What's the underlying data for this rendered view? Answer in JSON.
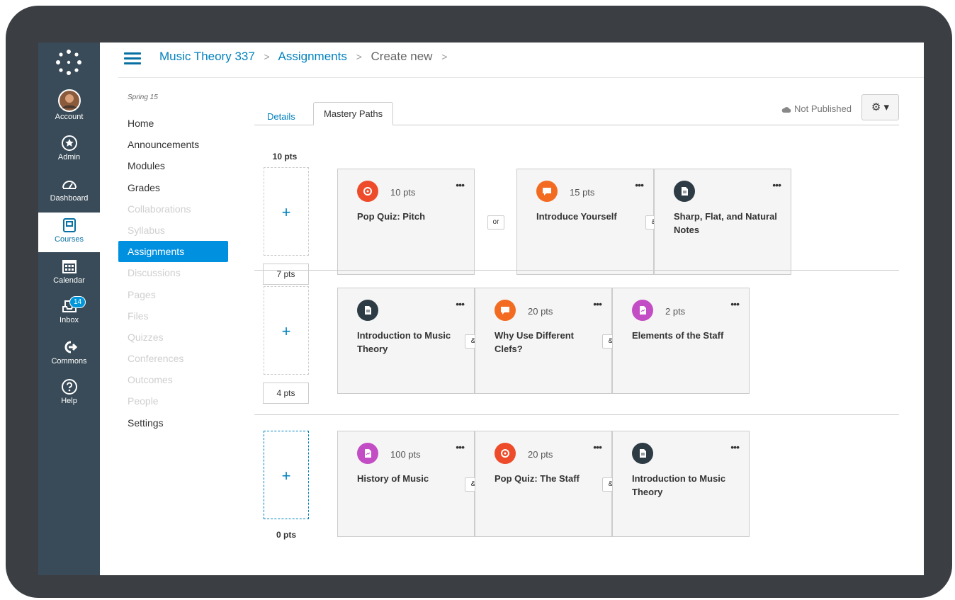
{
  "nav": {
    "account": "Account",
    "admin": "Admin",
    "dashboard": "Dashboard",
    "courses": "Courses",
    "calendar": "Calendar",
    "inbox": "Inbox",
    "inbox_count": "14",
    "commons": "Commons",
    "help": "Help"
  },
  "breadcrumb": {
    "course": "Music Theory 337",
    "section": "Assignments",
    "current": "Create new",
    "sep": ">"
  },
  "course_nav": {
    "term": "Spring 15",
    "items": [
      "Home",
      "Announcements",
      "Modules",
      "Grades",
      "Collaborations",
      "Syllabus",
      "Assignments",
      "Discussions",
      "Pages",
      "Files",
      "Quizzes",
      "Conferences",
      "Outcomes",
      "People",
      "Settings"
    ]
  },
  "tabs": {
    "details": "Details",
    "mastery": "Mastery Paths"
  },
  "status": {
    "published": "Not Published",
    "gear": "⚙ ▾"
  },
  "add_symbol": "+",
  "more_symbol": "•••",
  "rows": [
    {
      "top_label": "10 pts",
      "bottom_label": "7 pts",
      "cards": [
        {
          "icon": "quiz-icon",
          "color": "#ee4b2b",
          "pts": "10 pts",
          "title": "Pop Quiz: Pitch"
        },
        {
          "icon": "discussion-icon",
          "color": "#f26b21",
          "pts": "15 pts",
          "title": "Introduce Yourself"
        },
        {
          "icon": "page-icon",
          "color": "#2d3b45",
          "pts": "",
          "title": "Sharp, Flat, and Natural Notes"
        }
      ],
      "connectors": [
        "or",
        "&"
      ]
    },
    {
      "top_label": "",
      "bottom_label": "4 pts",
      "cards": [
        {
          "icon": "page-icon",
          "color": "#2d3b45",
          "pts": "",
          "title": "Introduction to Music Theory"
        },
        {
          "icon": "discussion-icon",
          "color": "#f26b21",
          "pts": "20 pts",
          "title": "Why Use Different Clefs?"
        },
        {
          "icon": "assignment-icon",
          "color": "#c34dc4",
          "pts": "2 pts",
          "title": "Elements of the Staff"
        }
      ],
      "connectors": [
        "&",
        "&"
      ]
    },
    {
      "top_label": "",
      "bottom_label": "0 pts",
      "cards": [
        {
          "icon": "assignment-icon",
          "color": "#c34dc4",
          "pts": "100 pts",
          "title": "History of Music"
        },
        {
          "icon": "quiz-icon",
          "color": "#ee4b2b",
          "pts": "20 pts",
          "title": "Pop Quiz: The Staff"
        },
        {
          "icon": "page-icon",
          "color": "#2d3b45",
          "pts": "",
          "title": "Introduction to Music Theory"
        }
      ],
      "connectors": [
        "&",
        "&"
      ]
    }
  ]
}
